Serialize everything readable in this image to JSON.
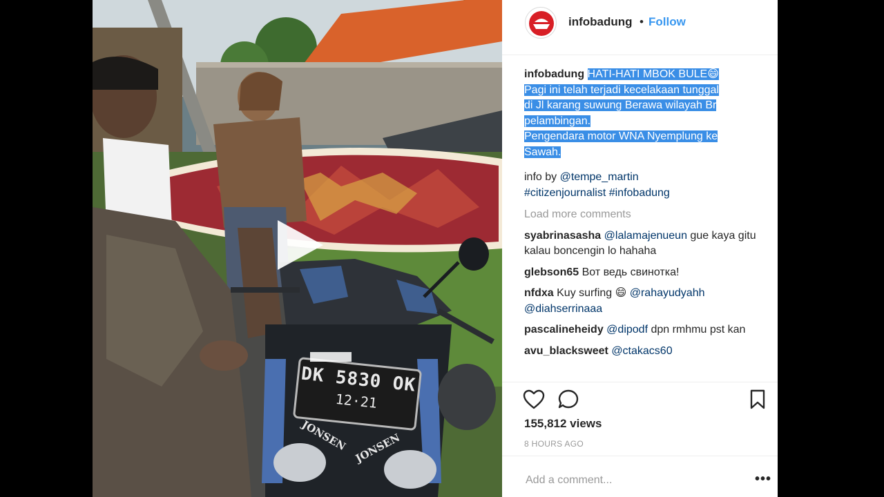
{
  "post": {
    "username": "infobadung",
    "separator": "•",
    "follow_label": "Follow"
  },
  "caption": {
    "username": "infobadung",
    "lines": [
      "HATI-HATI MBOK BULE😄",
      "Pagi ini telah terjadi kecelakaan tunggal",
      "di Jl karang suwung Berawa wilayah Br",
      "pelambingan.",
      "Pengendara motor WNA Nyemplung ke",
      "Sawah."
    ],
    "info_prefix": "info by ",
    "info_mention": "@tempe_martin",
    "hashtags": "#citizenjournalist #infobadung"
  },
  "load_more_label": "Load more comments",
  "comments": [
    {
      "user": "syabrinasasha",
      "mention": "@lalamajenueun",
      "text": " gue kaya gitu kalau boncengin lo hahaha"
    },
    {
      "user": "glebson65",
      "mention": "",
      "text": "Вот ведь свинотка!"
    },
    {
      "user": "nfdxa",
      "mention": "",
      "text": "Kuy surfing 😄 ",
      "mention2": "@rahayudyahh @diahserrinaaa"
    },
    {
      "user": "pascalineheidy",
      "mention": "@dipodf",
      "text": " dpn rmhmu pst kan"
    },
    {
      "user": "avu_blacksweet",
      "mention": "@ctakacs60",
      "text": ""
    }
  ],
  "stats": {
    "views": "155,812 views",
    "time_ago": "8 HOURS AGO"
  },
  "add_comment": {
    "placeholder": "Add a comment...",
    "more_label": "•••"
  },
  "video": {
    "plate_line1": "DK 5830 OK",
    "plate_line2": "12·21",
    "sticker_left": "JONSEN",
    "sticker_right": "JONSEN"
  },
  "icons": {
    "play": "play-icon",
    "like": "heart-icon",
    "comment": "comment-bubble-icon",
    "save": "bookmark-icon",
    "more": "more-options-icon"
  },
  "colors": {
    "follow": "#3897f0",
    "highlight": "#3a8ee6",
    "mention": "#003569",
    "muted": "#999999"
  }
}
